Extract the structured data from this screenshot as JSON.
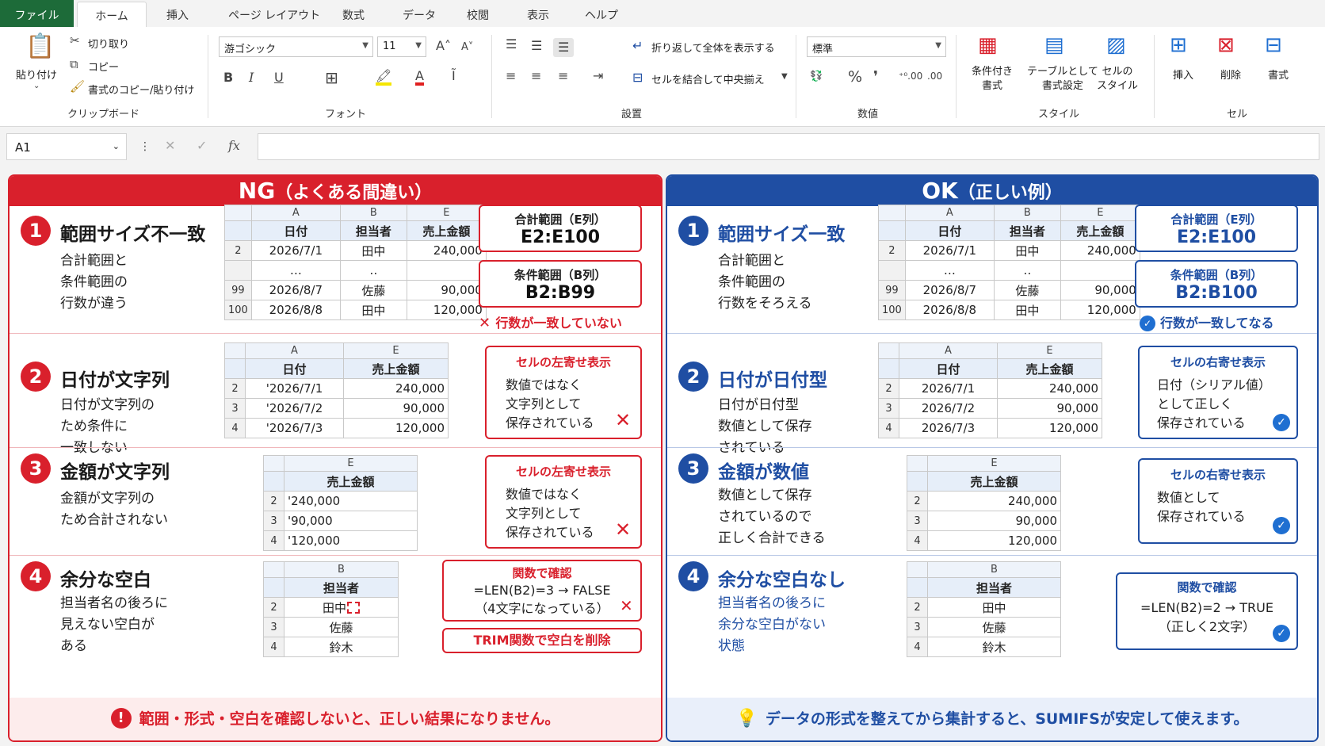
{
  "tabs": [
    "ファイル",
    "ホーム",
    "挿入",
    "ページ レイアウト",
    "数式",
    "データ",
    "校閲",
    "表示",
    "ヘルプ"
  ],
  "ribbon": {
    "paste": "貼り付け",
    "cut": "切り取り",
    "copy": "コピー",
    "format_painter": "書式のコピー/貼り付け",
    "clipboard_label": "クリップボード",
    "font_name": "游ゴシック",
    "font_size": "11",
    "font_label": "フォント",
    "wrap_text": "折り返して全体を表示する",
    "merge_center": "セルを結合して中央揃え",
    "alignment_label": "設置",
    "number_format": "標準",
    "number_label": "数値",
    "cond_format": [
      "条件付き",
      "書式"
    ],
    "table_format": [
      "テーブルとして",
      "書式設定"
    ],
    "cell_style": [
      "セルの",
      "スタイル"
    ],
    "styles_label": "スタイル",
    "insert": "挿入",
    "delete": "削除",
    "format": "書式",
    "cells_label": "セル"
  },
  "formula_bar": {
    "name_box": "A1",
    "fx": "fx"
  },
  "ng": {
    "header_main": "NG",
    "header_sub": "（よくある間違い）",
    "r1": {
      "num": "1",
      "title": "範囲サイズ不一致",
      "desc": [
        "合計範囲と",
        "条件範囲の",
        "行数が違う"
      ],
      "cols": [
        "A",
        "B",
        "E"
      ],
      "hdr": [
        "日付",
        "担当者",
        "売上金額"
      ],
      "rows": [
        [
          "2",
          "2026/7/1",
          "田中",
          "240,000"
        ],
        [
          "",
          "…",
          "‥",
          ""
        ],
        [
          "99",
          "2026/8/7",
          "佐藤",
          "90,000"
        ],
        [
          "100",
          "2026/8/8",
          "田中",
          "120,000"
        ]
      ],
      "box1_label": "合計範囲（E列）",
      "box1_value": "E2:E100",
      "box2_label": "条件範囲（B列）",
      "box2_value": "B2:B99",
      "note": "行数が一致していない"
    },
    "r2": {
      "num": "2",
      "title": "日付が文字列",
      "desc": [
        "日付が文字列の",
        "ため条件に",
        "一致しない"
      ],
      "cols": [
        "A",
        "E"
      ],
      "hdr": [
        "日付",
        "売上金額"
      ],
      "rows": [
        [
          "2",
          "'2026/7/1",
          "240,000"
        ],
        [
          "3",
          "'2026/7/2",
          "90,000"
        ],
        [
          "4",
          "'2026/7/3",
          "120,000"
        ]
      ],
      "box_label": "セルの左寄せ表示",
      "box_text": [
        "数値ではなく",
        "文字列として",
        "保存されている"
      ]
    },
    "r3": {
      "num": "3",
      "title": "金額が文字列",
      "desc": [
        "金額が文字列の",
        "ため合計されない"
      ],
      "cols": [
        "E"
      ],
      "hdr": [
        "売上金額"
      ],
      "rows": [
        [
          "2",
          "'240,000"
        ],
        [
          "3",
          "'90,000"
        ],
        [
          "4",
          "'120,000"
        ]
      ],
      "box_label": "セルの左寄せ表示",
      "box_text": [
        "数値ではなく",
        "文字列として",
        "保存されている"
      ]
    },
    "r4": {
      "num": "4",
      "title": "余分な空白",
      "desc": [
        "担当者名の後ろに",
        "見えない空白が",
        "ある"
      ],
      "cols": [
        "B"
      ],
      "hdr": [
        "担当者"
      ],
      "rows": [
        [
          "2",
          "田中"
        ],
        [
          "3",
          "佐藤"
        ],
        [
          "4",
          "鈴木"
        ]
      ],
      "box_label": "関数で確認",
      "box_text": [
        "=LEN(B2)=3 → FALSE",
        "（4文字になっている）"
      ],
      "trim": "TRIM関数で空白を削除"
    },
    "footer": "範囲・形式・空白を確認しないと、正しい結果になりません。"
  },
  "ok": {
    "header_main": "OK",
    "header_sub": "（正しい例）",
    "r1": {
      "num": "1",
      "title": "範囲サイズ一致",
      "desc": [
        "合計範囲と",
        "条件範囲の",
        "行数をそろえる"
      ],
      "cols": [
        "A",
        "B",
        "E"
      ],
      "hdr": [
        "日付",
        "担当者",
        "売上金額"
      ],
      "rows": [
        [
          "2",
          "2026/7/1",
          "田中",
          "240,000"
        ],
        [
          "",
          "…",
          "‥",
          ""
        ],
        [
          "99",
          "2026/8/7",
          "佐藤",
          "90,000"
        ],
        [
          "100",
          "2026/8/8",
          "田中",
          "120,000"
        ]
      ],
      "box1_label": "合計範囲（E列）",
      "box1_value": "E2:E100",
      "box2_label": "条件範囲（B列）",
      "box2_value": "B2:B100",
      "note": "行数が一致してなる"
    },
    "r2": {
      "num": "2",
      "title": "日付が日付型",
      "desc": [
        "日付が日付型",
        "数値として保存",
        "されている"
      ],
      "cols": [
        "A",
        "E"
      ],
      "hdr": [
        "日付",
        "売上金額"
      ],
      "rows": [
        [
          "2",
          "2026/7/1",
          "240,000"
        ],
        [
          "3",
          "2026/7/2",
          "90,000"
        ],
        [
          "4",
          "2026/7/3",
          "120,000"
        ]
      ],
      "box_label": "セルの右寄せ表示",
      "box_text": [
        "日付（シリアル値）",
        "として正しく",
        "保存されている"
      ]
    },
    "r3": {
      "num": "3",
      "title": "金額が数値",
      "desc": [
        "数値として保存",
        "されているので",
        "正しく合計できる"
      ],
      "cols": [
        "E"
      ],
      "hdr": [
        "売上金額"
      ],
      "rows": [
        [
          "2",
          "240,000"
        ],
        [
          "3",
          "90,000"
        ],
        [
          "4",
          "120,000"
        ]
      ],
      "box_label": "セルの右寄せ表示",
      "box_text": [
        "数値として",
        "保存されている"
      ]
    },
    "r4": {
      "num": "4",
      "title": "余分な空白なし",
      "desc": [
        "担当者名の後ろに",
        "余分な空白がない",
        "状態"
      ],
      "cols": [
        "B"
      ],
      "hdr": [
        "担当者"
      ],
      "rows": [
        [
          "2",
          "田中"
        ],
        [
          "3",
          "佐藤"
        ],
        [
          "4",
          "鈴木"
        ]
      ],
      "box_label": "関数で確認",
      "box_text": [
        "=LEN(B2)=2 → TRUE",
        "（正しく2文字）"
      ]
    },
    "footer": "データの形式を整えてから集計すると、SUMIFSが安定して使えます。"
  },
  "colors": {
    "ng": "#d9202c",
    "ok": "#1f4ea3",
    "file_tab": "#1d6b39"
  }
}
